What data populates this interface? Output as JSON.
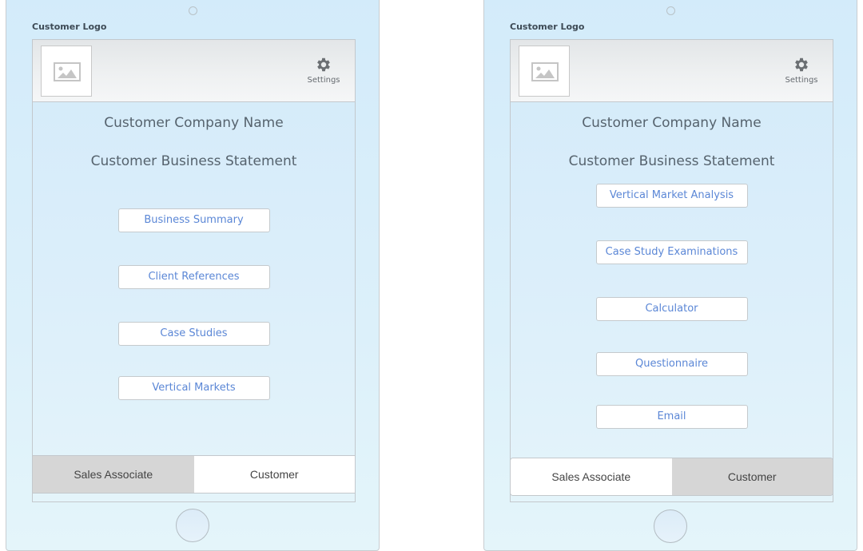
{
  "devices": {
    "left": {
      "logo_label": "Customer Logo",
      "settings_label": "Settings",
      "company_name": "Customer Company Name",
      "business_statement": "Customer Business Statement",
      "buttons": [
        {
          "label": "Business Summary"
        },
        {
          "label": "Client References"
        },
        {
          "label": "Case Studies"
        },
        {
          "label": "Vertical Markets"
        }
      ],
      "tabs": [
        {
          "label": "Sales Associate",
          "selected": true
        },
        {
          "label": "Customer",
          "selected": false
        }
      ]
    },
    "right": {
      "logo_label": "Customer Logo",
      "settings_label": "Settings",
      "company_name": "Customer Company Name",
      "business_statement": "Customer Business Statement",
      "buttons": [
        {
          "label": "Vertical Market Analysis"
        },
        {
          "label": "Case Study Examinations"
        },
        {
          "label": "Calculator"
        },
        {
          "label": "Questionnaire"
        },
        {
          "label": "Email"
        }
      ],
      "tabs": [
        {
          "label": "Sales Associate",
          "selected": false
        },
        {
          "label": "Customer",
          "selected": true
        }
      ]
    }
  },
  "icons": {
    "logo_placeholder": "image-placeholder-icon",
    "settings": "gear-icon"
  },
  "colors": {
    "button_text": "#5b87d6",
    "selected_tab": "#d6d6d6",
    "unselected_tab": "#ffffff",
    "heading_text": "#56636e"
  }
}
